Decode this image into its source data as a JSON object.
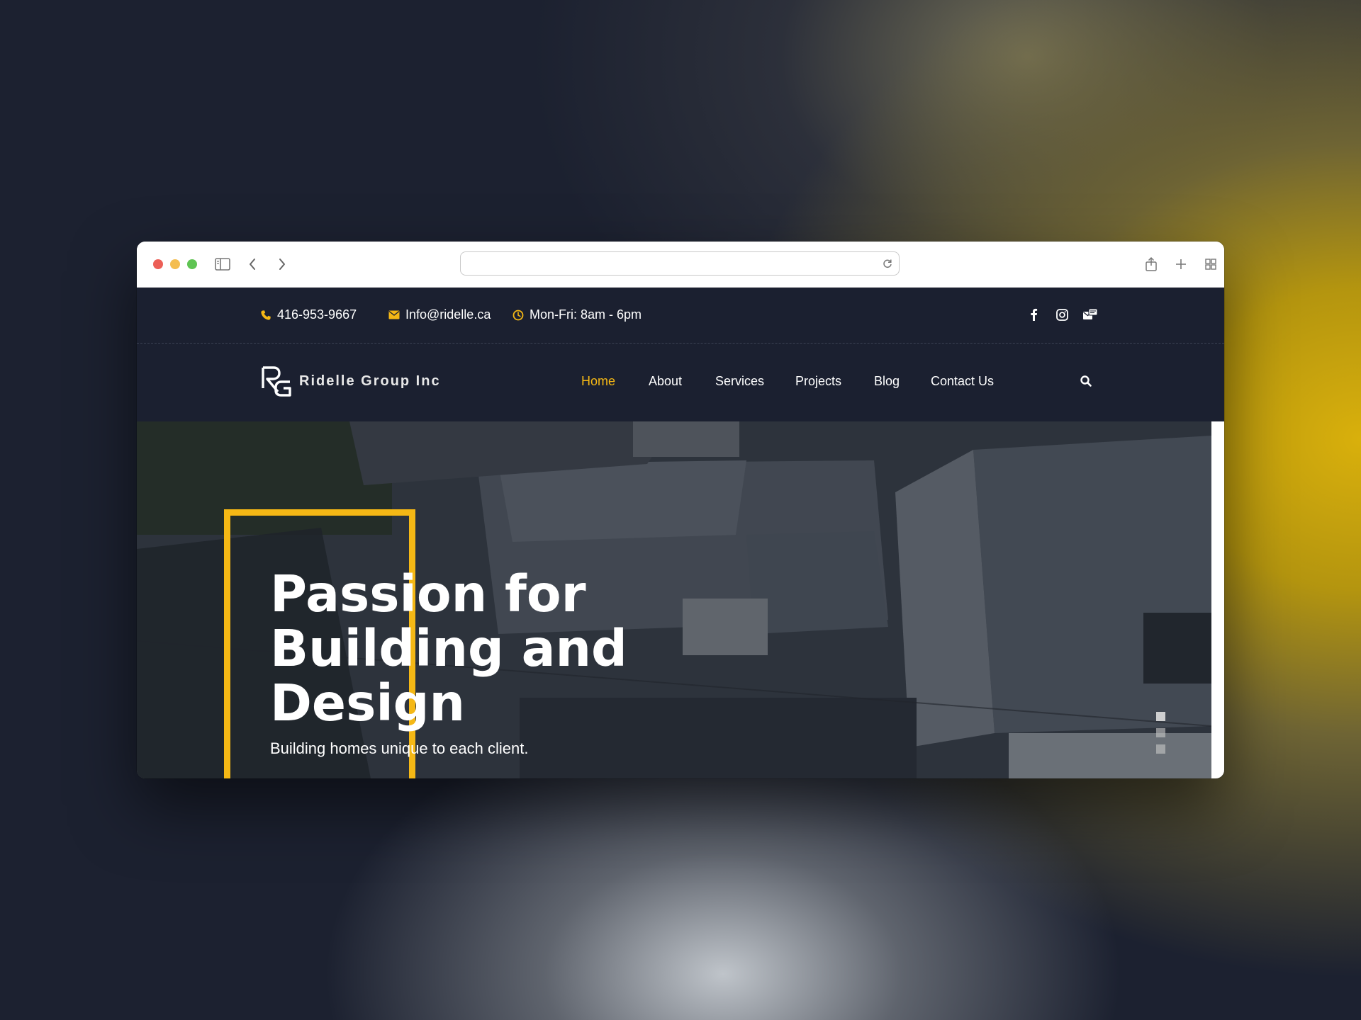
{
  "topbar": {
    "phone": "416-953-9667",
    "email": "Info@ridelle.ca",
    "hours": "Mon-Fri: 8am - 6pm",
    "social_icons": [
      "facebook-icon",
      "instagram-icon",
      "mail-chat-icon"
    ]
  },
  "brand": {
    "logo_mark": "RG",
    "name": "Ridelle Group Inc"
  },
  "nav": {
    "items": [
      {
        "label": "Home",
        "active": true
      },
      {
        "label": "About",
        "active": false
      },
      {
        "label": "Services",
        "active": false
      },
      {
        "label": "Projects",
        "active": false
      },
      {
        "label": "Blog",
        "active": false
      },
      {
        "label": "Contact Us",
        "active": false
      }
    ]
  },
  "hero": {
    "title_lines": [
      "Passion for",
      "Building and",
      "Design"
    ],
    "subtitle": "Building homes unique to each client.",
    "slides": 3,
    "active_slide": 1
  },
  "colors": {
    "accent": "#f5b815",
    "dark": "#1b2030",
    "text": "#ffffff"
  }
}
